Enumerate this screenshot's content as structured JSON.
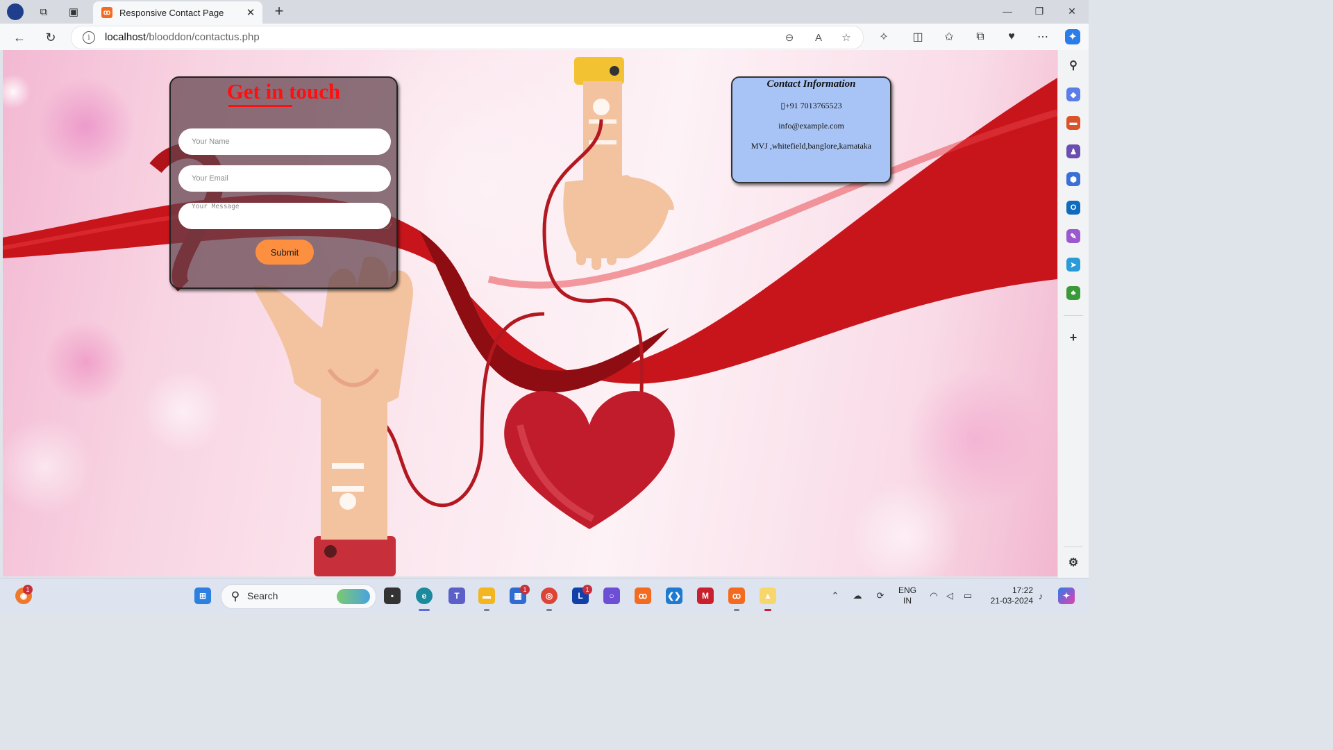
{
  "browser": {
    "tab_title": "Responsive Contact Page",
    "url_host": "localhost",
    "url_path": "/blooddon/contactus.php"
  },
  "form": {
    "title": "Get in touch",
    "name_placeholder": "Your Name",
    "email_placeholder": "Your Email",
    "message_placeholder": "Your Message",
    "submit_label": "Submit"
  },
  "contact_info": {
    "title": "Contact Information",
    "phone": "▯+91 7013765523",
    "email": "info@example.com",
    "address": "MVJ ,whitefield,banglore,karnataka"
  },
  "taskbar": {
    "search_label": "Search",
    "lang_top": "ENG",
    "lang_bottom": "IN",
    "time": "17:22",
    "date": "21-03-2024",
    "badges": {
      "firefox": "1",
      "store": "1",
      "teams_l": "1"
    }
  },
  "colors": {
    "title_red": "#ff1010",
    "submit_orange": "#fd9040",
    "info_blue": "#a8c4f6"
  }
}
